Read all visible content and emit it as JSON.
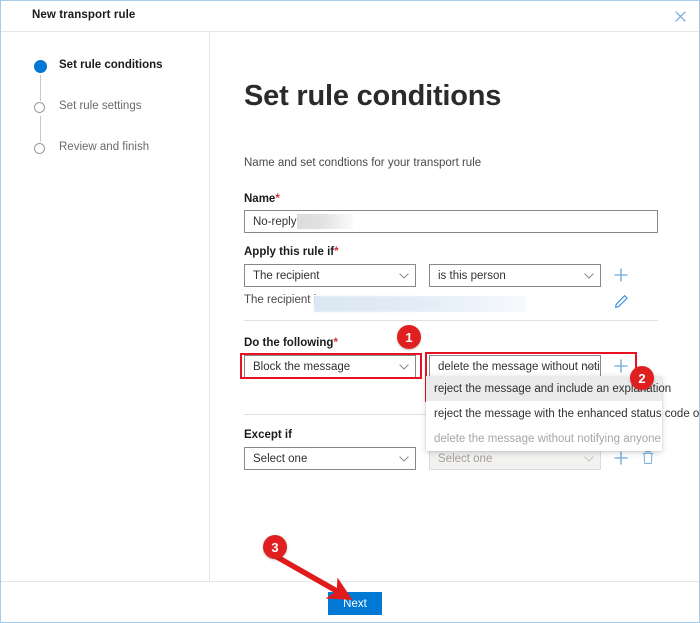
{
  "window": {
    "title": "New transport rule",
    "close_icon": "close-icon"
  },
  "sidebar": {
    "steps": [
      {
        "label": "Set rule conditions",
        "state": "active"
      },
      {
        "label": "Set rule settings",
        "state": "pending"
      },
      {
        "label": "Review and finish",
        "state": "pending"
      }
    ]
  },
  "main": {
    "page_title": "Set rule conditions",
    "subtitle": "Name and set condtions for your transport rule",
    "name_field": {
      "label": "Name",
      "required_marker": "*",
      "value": "No-reply",
      "redacted": true
    },
    "apply_rule_if": {
      "label": "Apply this rule if",
      "required_marker": "*",
      "condition_value": "The recipient",
      "operator_value": "is this person",
      "add_icon": "plus-icon",
      "detail_prefix": "The recipient is",
      "detail_redacted": true,
      "edit_icon": "pencil-icon"
    },
    "do_the_following": {
      "label": "Do the following",
      "required_marker": "*",
      "action_value": "Block the message",
      "detail_value": "delete the message without notif...",
      "add_icon": "plus-icon",
      "options": [
        {
          "label": "reject the message and include an explanation",
          "state": "hover"
        },
        {
          "label": "reject the message with the enhanced status code of",
          "state": "normal"
        },
        {
          "label": "delete the message without notifying anyone",
          "state": "disabled"
        }
      ]
    },
    "except_if": {
      "label": "Except if",
      "condition_value": "Select one",
      "detail_value": "Select one",
      "detail_disabled": true,
      "add_icon": "plus-icon",
      "delete_icon": "trash-icon"
    }
  },
  "footer": {
    "next_label": "Next"
  },
  "annotations": {
    "badges": [
      {
        "number": "1"
      },
      {
        "number": "2"
      },
      {
        "number": "3"
      }
    ],
    "arrow": "red-arrow-pointing-to-next-button"
  },
  "colors": {
    "accent": "#0078d4",
    "annotation_red": "#e02020",
    "highlight_red": "#e81123",
    "required_red": "#d13438",
    "text_primary": "#1b1b1b",
    "text_secondary": "#6a6a6a",
    "border": "#8a8886"
  }
}
